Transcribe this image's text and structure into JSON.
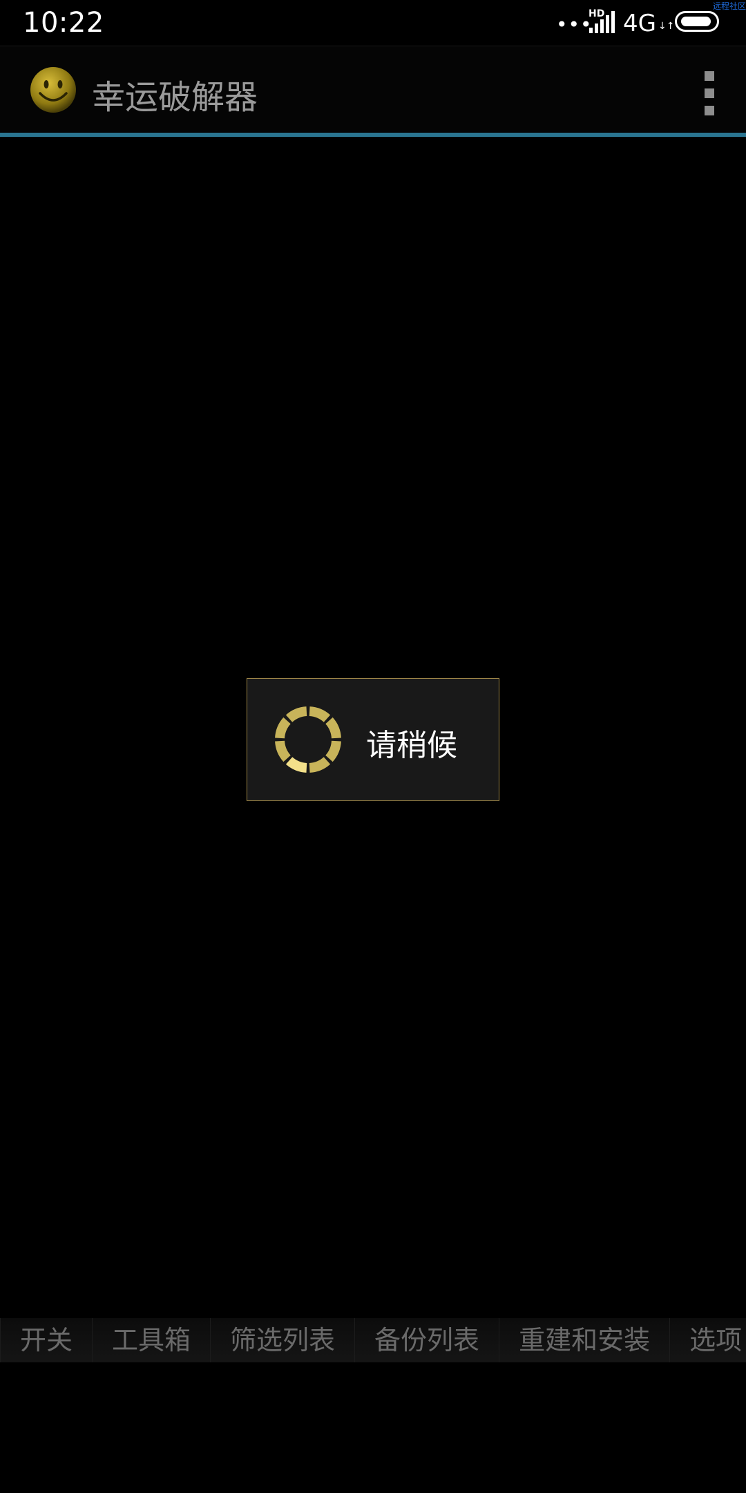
{
  "status_bar": {
    "time": "10:22",
    "watermark": "远程社区",
    "dots": "•••",
    "hd": "HD",
    "network": "4G",
    "network_arrows": "↓↑",
    "battery_icon": "battery-full-icon",
    "signal_icon": "signal-bars-icon"
  },
  "action_bar": {
    "app_icon": "smiley-face-icon",
    "title": "幸运破解器",
    "overflow_icon": "overflow-menu-icon",
    "accent_line_color": "#2a7591"
  },
  "dialog": {
    "message": "请稍候",
    "spinner_icon": "loading-spinner-icon",
    "border_color": "#a08848",
    "spinner_color": "#c8b45a"
  },
  "tabs": [
    {
      "label": "开关"
    },
    {
      "label": "工具箱"
    },
    {
      "label": "筛选列表"
    },
    {
      "label": "备份列表"
    },
    {
      "label": "重建和安装"
    },
    {
      "label": "选项"
    }
  ]
}
